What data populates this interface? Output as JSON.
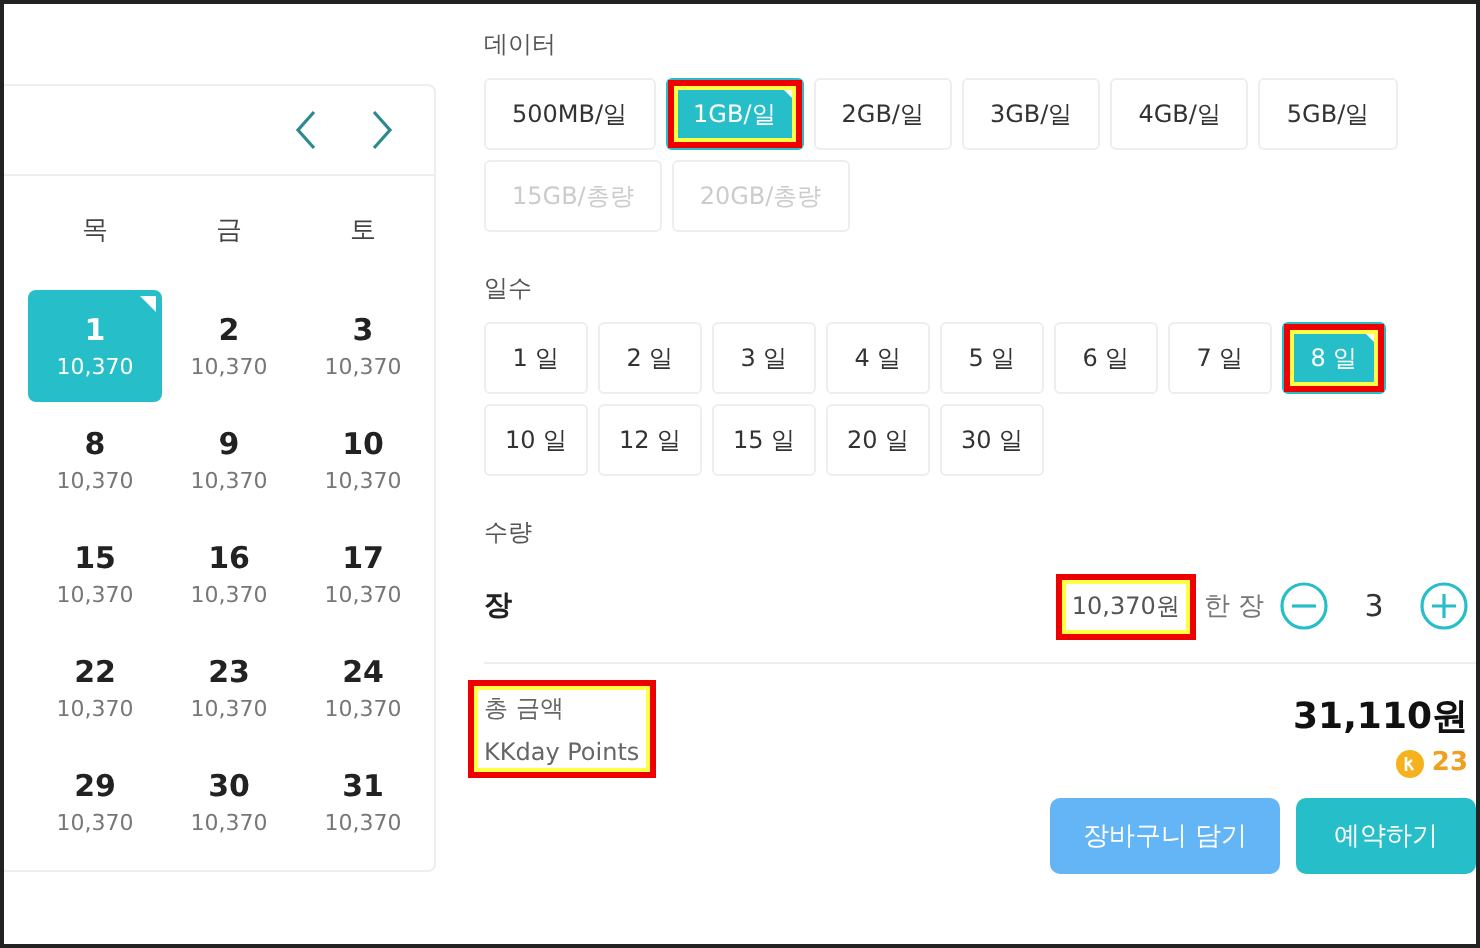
{
  "calendar": {
    "weekdays": [
      "목",
      "금",
      "토"
    ],
    "days": [
      {
        "day": "1",
        "price": "10,370",
        "selected": true
      },
      {
        "day": "2",
        "price": "10,370",
        "selected": false
      },
      {
        "day": "3",
        "price": "10,370",
        "selected": false
      },
      {
        "day": "8",
        "price": "10,370",
        "selected": false
      },
      {
        "day": "9",
        "price": "10,370",
        "selected": false
      },
      {
        "day": "10",
        "price": "10,370",
        "selected": false
      },
      {
        "day": "15",
        "price": "10,370",
        "selected": false
      },
      {
        "day": "16",
        "price": "10,370",
        "selected": false
      },
      {
        "day": "17",
        "price": "10,370",
        "selected": false
      },
      {
        "day": "22",
        "price": "10,370",
        "selected": false
      },
      {
        "day": "23",
        "price": "10,370",
        "selected": false
      },
      {
        "day": "24",
        "price": "10,370",
        "selected": false
      },
      {
        "day": "29",
        "price": "10,370",
        "selected": false
      },
      {
        "day": "30",
        "price": "10,370",
        "selected": false
      },
      {
        "day": "31",
        "price": "10,370",
        "selected": false
      }
    ]
  },
  "data": {
    "label": "데이터",
    "options": [
      {
        "label": "500MB/일",
        "selected": false,
        "disabled": false,
        "highlighted": false
      },
      {
        "label": "1GB/일",
        "selected": true,
        "disabled": false,
        "highlighted": true
      },
      {
        "label": "2GB/일",
        "selected": false,
        "disabled": false,
        "highlighted": false
      },
      {
        "label": "3GB/일",
        "selected": false,
        "disabled": false,
        "highlighted": false
      },
      {
        "label": "4GB/일",
        "selected": false,
        "disabled": false,
        "highlighted": false
      },
      {
        "label": "5GB/일",
        "selected": false,
        "disabled": false,
        "highlighted": false
      },
      {
        "label": "15GB/총량",
        "selected": false,
        "disabled": true,
        "highlighted": false
      },
      {
        "label": "20GB/총량",
        "selected": false,
        "disabled": true,
        "highlighted": false
      }
    ]
  },
  "days": {
    "label": "일수",
    "options": [
      {
        "label": "1 일",
        "selected": false,
        "disabled": false,
        "highlighted": false
      },
      {
        "label": "2 일",
        "selected": false,
        "disabled": false,
        "highlighted": false
      },
      {
        "label": "3 일",
        "selected": false,
        "disabled": false,
        "highlighted": false
      },
      {
        "label": "4 일",
        "selected": false,
        "disabled": false,
        "highlighted": false
      },
      {
        "label": "5 일",
        "selected": false,
        "disabled": false,
        "highlighted": false
      },
      {
        "label": "6 일",
        "selected": false,
        "disabled": false,
        "highlighted": false
      },
      {
        "label": "7 일",
        "selected": false,
        "disabled": false,
        "highlighted": false
      },
      {
        "label": "8 일",
        "selected": true,
        "disabled": false,
        "highlighted": true
      },
      {
        "label": "10 일",
        "selected": false,
        "disabled": false,
        "highlighted": false
      },
      {
        "label": "12 일",
        "selected": false,
        "disabled": false,
        "highlighted": false
      },
      {
        "label": "15 일",
        "selected": false,
        "disabled": false,
        "highlighted": false
      },
      {
        "label": "20 일",
        "selected": false,
        "disabled": false,
        "highlighted": false
      },
      {
        "label": "30 일",
        "selected": false,
        "disabled": false,
        "highlighted": false
      }
    ]
  },
  "quantity": {
    "label": "수량",
    "unit": "장",
    "price": "10,370원",
    "price_highlighted": true,
    "per": "한 장",
    "value": "3"
  },
  "total": {
    "label": "총 금액",
    "points_label": "KKday Points",
    "label_highlighted": true,
    "amount": "31,110원",
    "points": "23"
  },
  "buttons": [
    {
      "label": "장바구니 담기",
      "kind": "secondary"
    },
    {
      "label": "예약하기",
      "kind": "primary"
    }
  ]
}
